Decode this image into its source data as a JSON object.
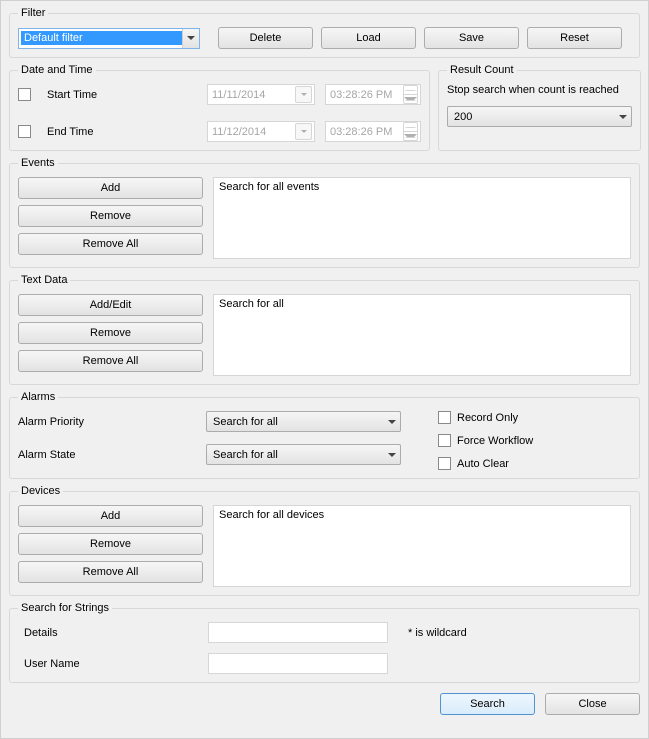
{
  "filter": {
    "legend": "Filter",
    "selected": "Default filter",
    "buttons": {
      "delete": "Delete",
      "load": "Load",
      "save": "Save",
      "reset": "Reset"
    }
  },
  "datetime": {
    "legend": "Date and Time",
    "start_label": "Start Time",
    "start_date": "11/11/2014",
    "start_time": "03:28:26 PM",
    "end_label": "End Time",
    "end_date": "11/12/2014",
    "end_time": "03:28:26 PM"
  },
  "result_count": {
    "legend": "Result Count",
    "hint": "Stop search when count is reached",
    "value": "200"
  },
  "events": {
    "legend": "Events",
    "add": "Add",
    "remove": "Remove",
    "remove_all": "Remove All",
    "list_text": "Search for all events"
  },
  "text_data": {
    "legend": "Text Data",
    "add_edit": "Add/Edit",
    "remove": "Remove",
    "remove_all": "Remove All",
    "list_text": "Search for all"
  },
  "alarms": {
    "legend": "Alarms",
    "priority_label": "Alarm Priority",
    "priority_value": "Search for all",
    "state_label": "Alarm State",
    "state_value": "Search for all",
    "record_only": "Record Only",
    "force_workflow": "Force Workflow",
    "auto_clear": "Auto Clear"
  },
  "devices": {
    "legend": "Devices",
    "add": "Add",
    "remove": "Remove",
    "remove_all": "Remove All",
    "list_text": "Search for all devices"
  },
  "strings": {
    "legend": "Search for Strings",
    "details_label": "Details",
    "details_value": "",
    "username_label": "User Name",
    "username_value": "",
    "wildcard_hint": "* is wildcard"
  },
  "footer": {
    "search": "Search",
    "close": "Close"
  }
}
